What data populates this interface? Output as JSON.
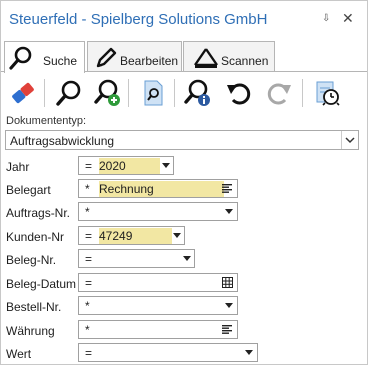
{
  "window": {
    "title": "Steuerfeld - Spielberg Solutions GmbH",
    "pin_glyph": "⇩",
    "close_glyph": "✕"
  },
  "tabs": [
    {
      "label": "Suche",
      "icon": "search-icon"
    },
    {
      "label": "Bearbeiten",
      "icon": "pencil-icon"
    },
    {
      "label": "Scannen",
      "icon": "scanner-icon"
    }
  ],
  "toolbar": [
    "eraser-icon",
    "search-icon",
    "search-add-icon",
    "document-search-icon",
    "search-info-icon",
    "undo-icon",
    "redo-icon",
    "calendar-alarm-icon"
  ],
  "doc_type": {
    "label": "Dokumententyp:",
    "value": "Auftragsabwicklung"
  },
  "fields": [
    {
      "label": "Jahr",
      "op": "=",
      "value": "2020",
      "control": "dropdown",
      "highlighted": true
    },
    {
      "label": "Belegart",
      "op": "*",
      "value": "Rechnung",
      "control": "list",
      "highlighted": true
    },
    {
      "label": "Auftrags-Nr.",
      "op": "*",
      "value": "",
      "control": "dropdown",
      "highlighted": false
    },
    {
      "label": "Kunden-Nr",
      "op": "=",
      "value": "47249",
      "control": "dropdown",
      "highlighted": true
    },
    {
      "label": "Beleg-Nr.",
      "op": "=",
      "value": "",
      "control": "dropdown",
      "highlighted": false
    },
    {
      "label": "Beleg-Datum",
      "op": "=",
      "value": "",
      "control": "calendar",
      "highlighted": false
    },
    {
      "label": "Bestell-Nr.",
      "op": "*",
      "value": "",
      "control": "dropdown",
      "highlighted": false
    },
    {
      "label": "Währung",
      "op": "*",
      "value": "",
      "control": "list",
      "highlighted": false
    },
    {
      "label": "Wert",
      "op": "=",
      "value": "",
      "control": "dropdown",
      "highlighted": false
    }
  ],
  "colors": {
    "title": "#2f6fb6",
    "highlight": "#f2e7a3"
  }
}
